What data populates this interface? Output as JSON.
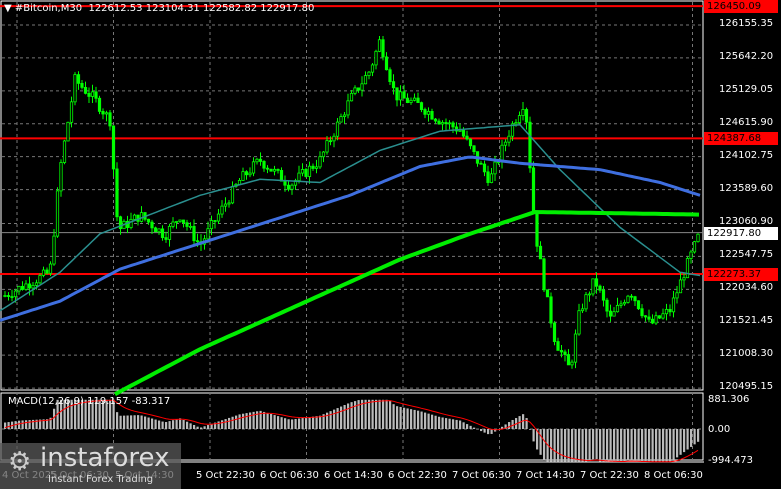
{
  "header": {
    "symbol": "#Bitcoin,M30",
    "open": "122612.53",
    "high": "123104.31",
    "low": "122582.82",
    "close": "122917.80"
  },
  "price_axis": [
    "126155.35",
    "125642.20",
    "125129.05",
    "124615.90",
    "124102.75",
    "123589.60",
    "123060.90",
    "122547.75",
    "122034.60",
    "121521.45",
    "121008.30",
    "120495.15"
  ],
  "levels": [
    {
      "label": "126450.09",
      "price": 126450.09
    },
    {
      "label": "124387.68",
      "price": 124387.68
    },
    {
      "label": "122273.37",
      "price": 122273.37
    }
  ],
  "current_price": {
    "label": "122917.80",
    "price": 122917.8
  },
  "macd": {
    "label": "MACD(12,26,9) 119.157 -83.317",
    "axis": [
      "881.306",
      "0.00",
      "-994.473"
    ]
  },
  "time_axis": [
    "4 Oct 2025",
    "5 Oct 06:30",
    "5 Oct 14:30",
    "5 Oct 22:30",
    "6 Oct 06:30",
    "6 Oct 14:30",
    "6 Oct 22:30",
    "7 Oct 06:30",
    "7 Oct 14:30",
    "7 Oct 22:30",
    "8 Oct 06:30"
  ],
  "watermark": {
    "brand": "instaforex",
    "tagline": "Instant Forex Trading"
  },
  "colors": {
    "bull": "#00ff00",
    "bear": "#00ff00",
    "level": "#ff0000",
    "ma_fast": "#2a8f8f",
    "ma_mid": "#3f6fe0",
    "ma_slow": "#00ee00"
  },
  "chart_data": {
    "type": "candlestick",
    "price_path": [
      [
        0,
        121900
      ],
      [
        50,
        122300
      ],
      [
        60,
        123900
      ],
      [
        75,
        125300
      ],
      [
        95,
        124990
      ],
      [
        110,
        124670
      ],
      [
        118,
        122960
      ],
      [
        140,
        123190
      ],
      [
        165,
        122880
      ],
      [
        180,
        123190
      ],
      [
        200,
        122720
      ],
      [
        215,
        123110
      ],
      [
        240,
        123740
      ],
      [
        260,
        124050
      ],
      [
        290,
        123660
      ],
      [
        320,
        124050
      ],
      [
        350,
        124990
      ],
      [
        370,
        125450
      ],
      [
        380,
        125920
      ],
      [
        395,
        125060
      ],
      [
        420,
        124900
      ],
      [
        440,
        124670
      ],
      [
        460,
        124520
      ],
      [
        480,
        123970
      ],
      [
        490,
        123740
      ],
      [
        510,
        124520
      ],
      [
        525,
        124990
      ],
      [
        535,
        122960
      ],
      [
        545,
        122020
      ],
      [
        555,
        121250
      ],
      [
        570,
        120780
      ],
      [
        580,
        121710
      ],
      [
        595,
        122180
      ],
      [
        610,
        121560
      ],
      [
        630,
        122020
      ],
      [
        650,
        121480
      ],
      [
        670,
        121710
      ],
      [
        685,
        122330
      ],
      [
        700,
        122918
      ]
    ],
    "ma_fast": [
      [
        0,
        121700
      ],
      [
        60,
        122300
      ],
      [
        100,
        122900
      ],
      [
        150,
        123200
      ],
      [
        200,
        123500
      ],
      [
        260,
        123750
      ],
      [
        320,
        123700
      ],
      [
        380,
        124200
      ],
      [
        440,
        124500
      ],
      [
        520,
        124600
      ],
      [
        560,
        123900
      ],
      [
        620,
        123000
      ],
      [
        680,
        122300
      ],
      [
        700,
        122250
      ]
    ],
    "ma_mid": [
      [
        0,
        121550
      ],
      [
        60,
        121850
      ],
      [
        120,
        122350
      ],
      [
        200,
        122750
      ],
      [
        280,
        123150
      ],
      [
        350,
        123500
      ],
      [
        420,
        123950
      ],
      [
        470,
        124100
      ],
      [
        520,
        124000
      ],
      [
        600,
        123900
      ],
      [
        660,
        123700
      ],
      [
        700,
        123500
      ]
    ],
    "ma_slow": [
      [
        115,
        120400
      ],
      [
        200,
        121100
      ],
      [
        300,
        121800
      ],
      [
        400,
        122500
      ],
      [
        470,
        122900
      ],
      [
        535,
        123240
      ],
      [
        620,
        123220
      ],
      [
        700,
        123200
      ]
    ]
  }
}
